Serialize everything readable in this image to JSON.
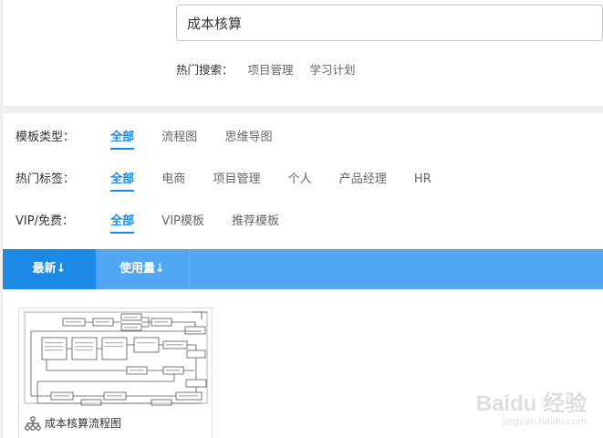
{
  "search": {
    "value": "成本核算"
  },
  "hot_search": {
    "label": "热门搜索：",
    "keywords": [
      "项目管理",
      "学习计划"
    ]
  },
  "filters": {
    "template_type": {
      "label": "模板类型：",
      "options": [
        "全部",
        "流程图",
        "思维导图"
      ]
    },
    "hot_tags": {
      "label": "热门标签：",
      "options": [
        "全部",
        "电商",
        "项目管理",
        "个人",
        "产品经理",
        "HR"
      ]
    },
    "vip": {
      "label": "VIP/免费：",
      "options": [
        "全部",
        "VIP模板",
        "推荐模板"
      ]
    }
  },
  "sort": {
    "newest": "最新↓",
    "usage": "使用量↓"
  },
  "templates": [
    {
      "title": "成本核算流程图",
      "icon": "flowchart-icon"
    }
  ],
  "watermark": {
    "main": "Baidu 经验",
    "sub": "jingyan.baidu.com"
  },
  "colors": {
    "accent": "#1a8ae6",
    "sort_bar": "#52a7f5"
  }
}
